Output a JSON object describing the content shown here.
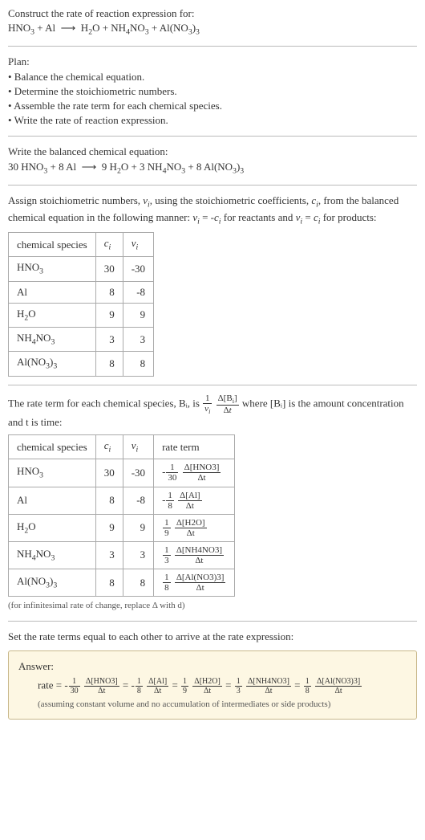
{
  "intro": {
    "construct": "Construct the rate of reaction expression for:",
    "eq_unbalanced": "HNO₃ + Al ⟶ H₂O + NH₄NO₃ + Al(NO₃)₃"
  },
  "plan": {
    "heading": "Plan:",
    "items": [
      "• Balance the chemical equation.",
      "• Determine the stoichiometric numbers.",
      "• Assemble the rate term for each chemical species.",
      "• Write the rate of reaction expression."
    ]
  },
  "balanced": {
    "heading": "Write the balanced chemical equation:",
    "eq": "30 HNO₃ + 8 Al ⟶ 9 H₂O + 3 NH₄NO₃ + 8 Al(NO₃)₃"
  },
  "stoich_text": "Assign stoichiometric numbers, νᵢ, using the stoichiometric coefficients, cᵢ, from the balanced chemical equation in the following manner: νᵢ = -cᵢ for reactants and νᵢ = cᵢ for products:",
  "table1": {
    "headers": [
      "chemical species",
      "cᵢ",
      "νᵢ"
    ],
    "rows": [
      {
        "species": "HNO₃",
        "c": "30",
        "v": "-30"
      },
      {
        "species": "Al",
        "c": "8",
        "v": "-8"
      },
      {
        "species": "H₂O",
        "c": "9",
        "v": "9"
      },
      {
        "species": "NH₄NO₃",
        "c": "3",
        "v": "3"
      },
      {
        "species": "Al(NO₃)₃",
        "c": "8",
        "v": "8"
      }
    ]
  },
  "rate_term_text_a": "The rate term for each chemical species, Bᵢ, is ",
  "rate_term_text_b": " where [Bᵢ] is the amount concentration and t is time:",
  "table2": {
    "headers": [
      "chemical species",
      "cᵢ",
      "νᵢ",
      "rate term"
    ],
    "rows": [
      {
        "species": "HNO₃",
        "c": "30",
        "v": "-30",
        "term": {
          "sign": "-",
          "fden": "30",
          "num": "Δ[HNO3]",
          "den": "Δt"
        }
      },
      {
        "species": "Al",
        "c": "8",
        "v": "-8",
        "term": {
          "sign": "-",
          "fden": "8",
          "num": "Δ[Al]",
          "den": "Δt"
        }
      },
      {
        "species": "H₂O",
        "c": "9",
        "v": "9",
        "term": {
          "sign": "",
          "fden": "9",
          "num": "Δ[H2O]",
          "den": "Δt"
        }
      },
      {
        "species": "NH₄NO₃",
        "c": "3",
        "v": "3",
        "term": {
          "sign": "",
          "fden": "3",
          "num": "Δ[NH4NO3]",
          "den": "Δt"
        }
      },
      {
        "species": "Al(NO₃)₃",
        "c": "8",
        "v": "8",
        "term": {
          "sign": "",
          "fden": "8",
          "num": "Δ[Al(NO3)3]",
          "den": "Δt"
        }
      }
    ]
  },
  "inf_note": "(for infinitesimal rate of change, replace Δ with d)",
  "set_equal": "Set the rate terms equal to each other to arrive at the rate expression:",
  "answer": {
    "heading": "Answer:",
    "prefix": "rate = ",
    "terms": [
      {
        "sign": "-",
        "fden": "30",
        "num": "Δ[HNO3]",
        "den": "Δt"
      },
      {
        "sign": "-",
        "fden": "8",
        "num": "Δ[Al]",
        "den": "Δt"
      },
      {
        "sign": "",
        "fden": "9",
        "num": "Δ[H2O]",
        "den": "Δt"
      },
      {
        "sign": "",
        "fden": "3",
        "num": "Δ[NH4NO3]",
        "den": "Δt"
      },
      {
        "sign": "",
        "fden": "8",
        "num": "Δ[Al(NO3)3]",
        "den": "Δt"
      }
    ],
    "assumption": "(assuming constant volume and no accumulation of intermediates or side products)"
  },
  "chart_data": {
    "type": "table",
    "title": "Stoichiometric numbers and rate terms",
    "columns": [
      "chemical species",
      "cᵢ",
      "νᵢ",
      "rate term"
    ],
    "rows": [
      [
        "HNO₃",
        30,
        -30,
        "-(1/30) Δ[HNO3]/Δt"
      ],
      [
        "Al",
        8,
        -8,
        "-(1/8) Δ[Al]/Δt"
      ],
      [
        "H₂O",
        9,
        9,
        "(1/9) Δ[H2O]/Δt"
      ],
      [
        "NH₄NO₃",
        3,
        3,
        "(1/3) Δ[NH4NO3]/Δt"
      ],
      [
        "Al(NO₃)₃",
        8,
        8,
        "(1/8) Δ[Al(NO3)3]/Δt"
      ]
    ]
  }
}
